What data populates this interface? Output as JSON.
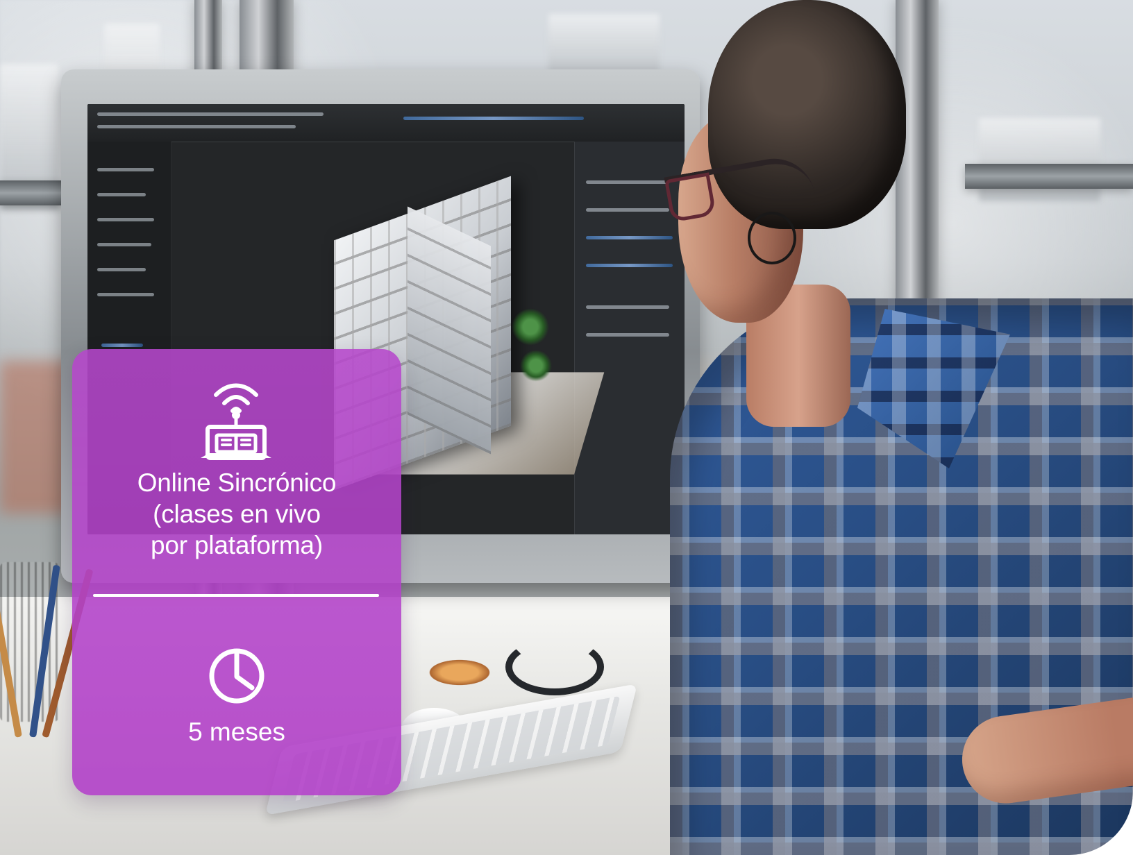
{
  "card": {
    "mode": "Online Sincrónico\n(clases en vivo\npor plataforma)",
    "duration": "5 meses",
    "background_color": "#B03CC7",
    "text_color": "#FFFFFF"
  },
  "icons": {
    "online_class": "wifi-laptop-book-icon",
    "duration": "clock-icon"
  }
}
